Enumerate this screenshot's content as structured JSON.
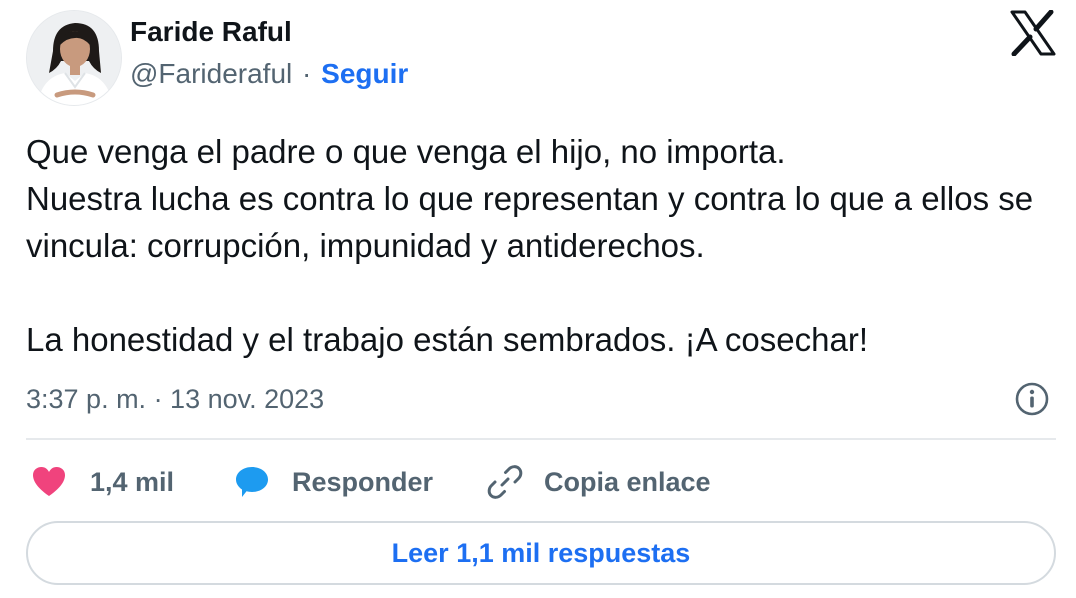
{
  "author": {
    "name": "Faride Raful",
    "handle": "@Farideraful",
    "separator": "·",
    "follow_label": "Seguir",
    "avatar_icon": "profile-photo"
  },
  "platform_icon": "x-logo-icon",
  "tweet": {
    "text": "Que venga el padre o que venga el hijo, no importa.\nNuestra lucha es contra lo que representan y contra lo que a ellos se vincula: corrupción, impunidad y antiderechos.\n\nLa honestidad y el trabajo están sembrados. ¡A cosechar!",
    "timestamp": "3:37 p. m. · 13 nov. 2023"
  },
  "actions": {
    "likes": {
      "count": "1,4 mil",
      "icon": "heart-icon",
      "color": "#f0437d"
    },
    "reply": {
      "label": "Responder",
      "icon": "speech-bubble-icon",
      "color": "#1d9bf0"
    },
    "copy_link": {
      "label": "Copia enlace",
      "icon": "link-icon"
    }
  },
  "read_replies_label": "Leer 1,1 mil respuestas",
  "colors": {
    "accent": "#1d6ff2",
    "muted": "#536471",
    "text": "#0f1419",
    "border": "#e6e9ec"
  }
}
